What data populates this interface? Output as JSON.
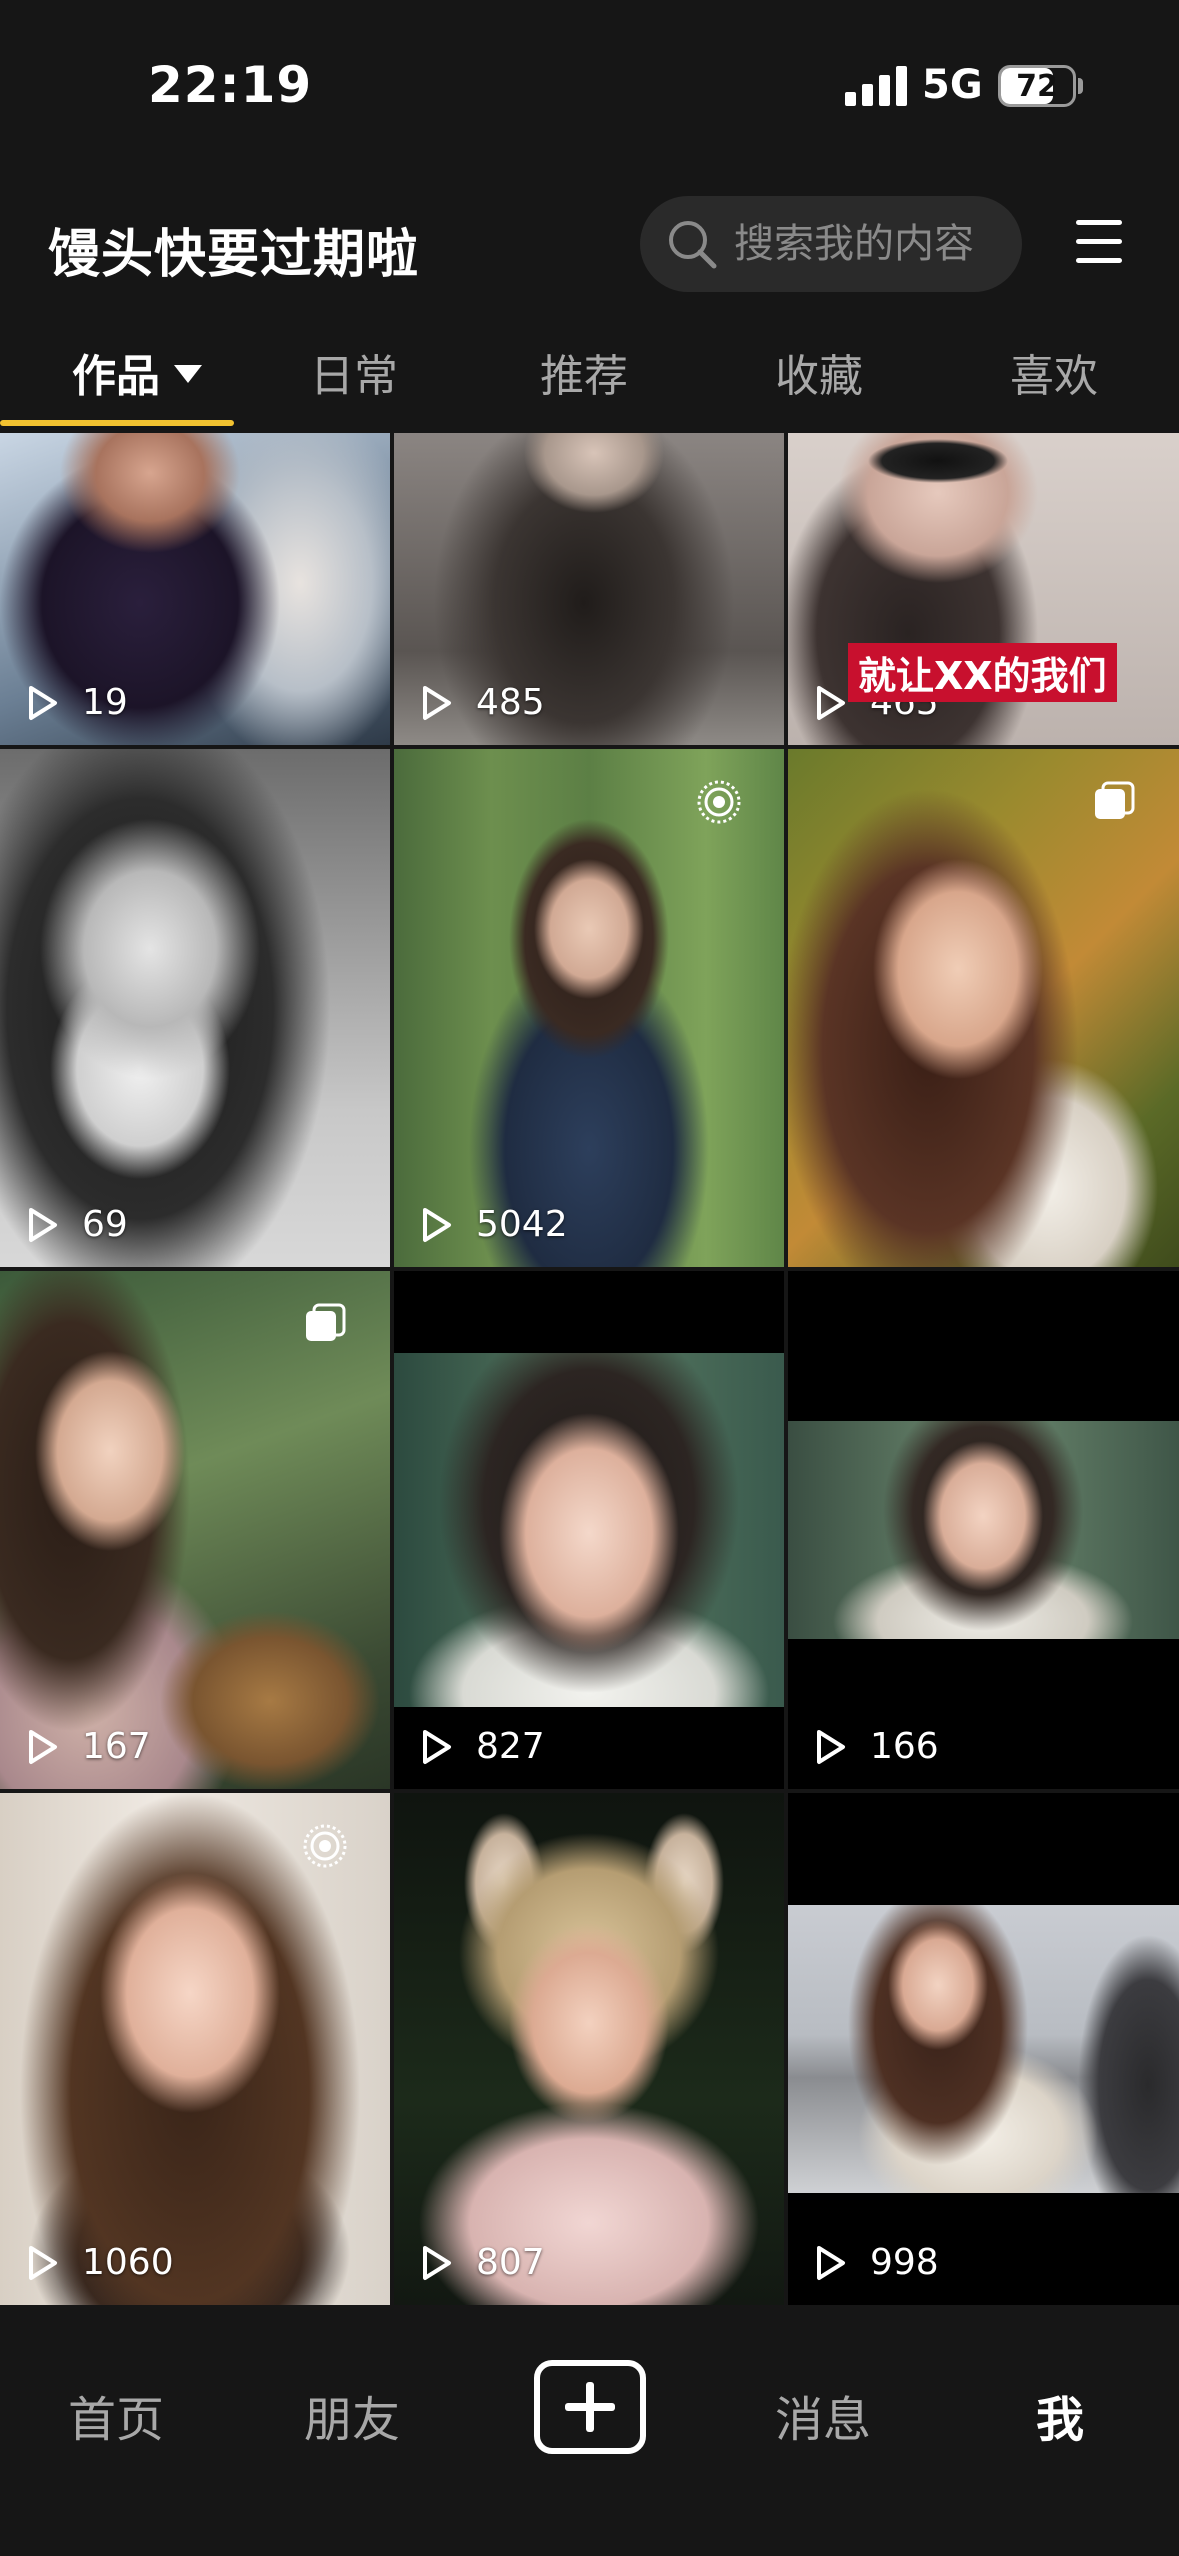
{
  "status_bar": {
    "time": "22:19",
    "network": "5G",
    "battery": "72",
    "battery_level": 0.72
  },
  "header": {
    "title": "馒头快要过期啦",
    "search_placeholder": "搜索我的内容"
  },
  "tabs": [
    {
      "label": "作品"
    },
    {
      "label": "日常"
    },
    {
      "label": "推荐"
    },
    {
      "label": "收藏"
    },
    {
      "label": "喜欢"
    }
  ],
  "grid": {
    "items": [
      {
        "views": "19",
        "subject": "hooded-girl-snow-photo",
        "badge": null
      },
      {
        "views": "485",
        "subject": "girl-dark-hair-grey-photo",
        "badge": null
      },
      {
        "views": "465",
        "subject": "girl-sunglasses-photo",
        "badge": null,
        "overlay": "就让XX的我们"
      },
      {
        "views": "69",
        "subject": "black-white-portrait-photo",
        "badge": null
      },
      {
        "views": "5042",
        "subject": "denim-jacket-girl-photo",
        "badge": "live-photo-icon"
      },
      {
        "views": "",
        "subject": "smiling-girl-garden-photo",
        "badge": "multi-image-icon"
      },
      {
        "views": "167",
        "subject": "girl-with-basket-photo",
        "badge": "multi-image-icon"
      },
      {
        "views": "827",
        "subject": "white-shirt-girl-photo",
        "badge": null
      },
      {
        "views": "166",
        "subject": "girl-hanfu-photo",
        "badge": null
      },
      {
        "views": "1060",
        "subject": "girl-long-hair-photo",
        "badge": "live-photo-icon"
      },
      {
        "views": "807",
        "subject": "cat-ears-girl-photo",
        "badge": null
      },
      {
        "views": "998",
        "subject": "girl-bracelet-photo",
        "badge": null
      }
    ]
  },
  "bottom_nav": {
    "home": "首页",
    "friends": "朋友",
    "messages": "消息",
    "me": "我"
  }
}
